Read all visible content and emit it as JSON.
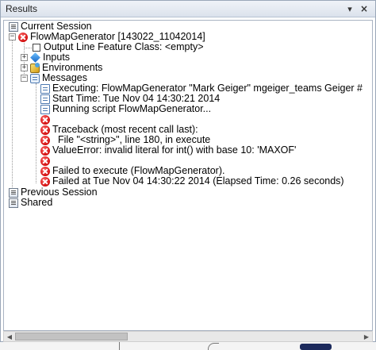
{
  "window": {
    "title": "Results",
    "pin_glyph": "▾",
    "close_glyph": "×"
  },
  "tree": {
    "current_session": {
      "label": "Current Session",
      "icon": "session-icon"
    },
    "tool": {
      "label": "FlowMapGenerator [143022_11042014]",
      "icon": "error-icon",
      "expanded": true
    },
    "output": {
      "label": "Output Line Feature Class: <empty>",
      "icon": "feature-class-icon"
    },
    "inputs": {
      "label": "Inputs",
      "icon": "inputs-icon",
      "expanded": false
    },
    "environments": {
      "label": "Environments",
      "icon": "environments-icon",
      "expanded": false
    },
    "messages_node": {
      "label": "Messages",
      "icon": "messages-icon",
      "expanded": true
    },
    "messages": [
      {
        "type": "info",
        "text": "Executing: FlowMapGenerator \"Mark Geiger\" mgeiger_teams Geiger #"
      },
      {
        "type": "info",
        "text": "Start Time: Tue Nov 04 14:30:21 2014"
      },
      {
        "type": "info",
        "text": "Running script FlowMapGenerator..."
      },
      {
        "type": "error",
        "text": ""
      },
      {
        "type": "error",
        "text": "Traceback (most recent call last):"
      },
      {
        "type": "error",
        "text": "  File \"<string>\", line 180, in execute"
      },
      {
        "type": "error",
        "text": "ValueError: invalid literal for int() with base 10: 'MAXOF'"
      },
      {
        "type": "error",
        "text": ""
      },
      {
        "type": "error",
        "text": "Failed to execute (FlowMapGenerator)."
      },
      {
        "type": "error",
        "text": "Failed at Tue Nov 04 14:30:22 2014 (Elapsed Time: 0.26 seconds)"
      }
    ],
    "previous_session": {
      "label": "Previous Session",
      "icon": "session-icon"
    },
    "shared": {
      "label": "Shared",
      "icon": "session-icon"
    },
    "expander_collapsed": "+",
    "expander_expanded": "−"
  },
  "scrollbar": {
    "left_glyph": "◀",
    "right_glyph": "▶"
  },
  "colors": {
    "error": "#d10a0a",
    "title_bar": "#dbe2ec",
    "border": "#9aa7b8"
  }
}
